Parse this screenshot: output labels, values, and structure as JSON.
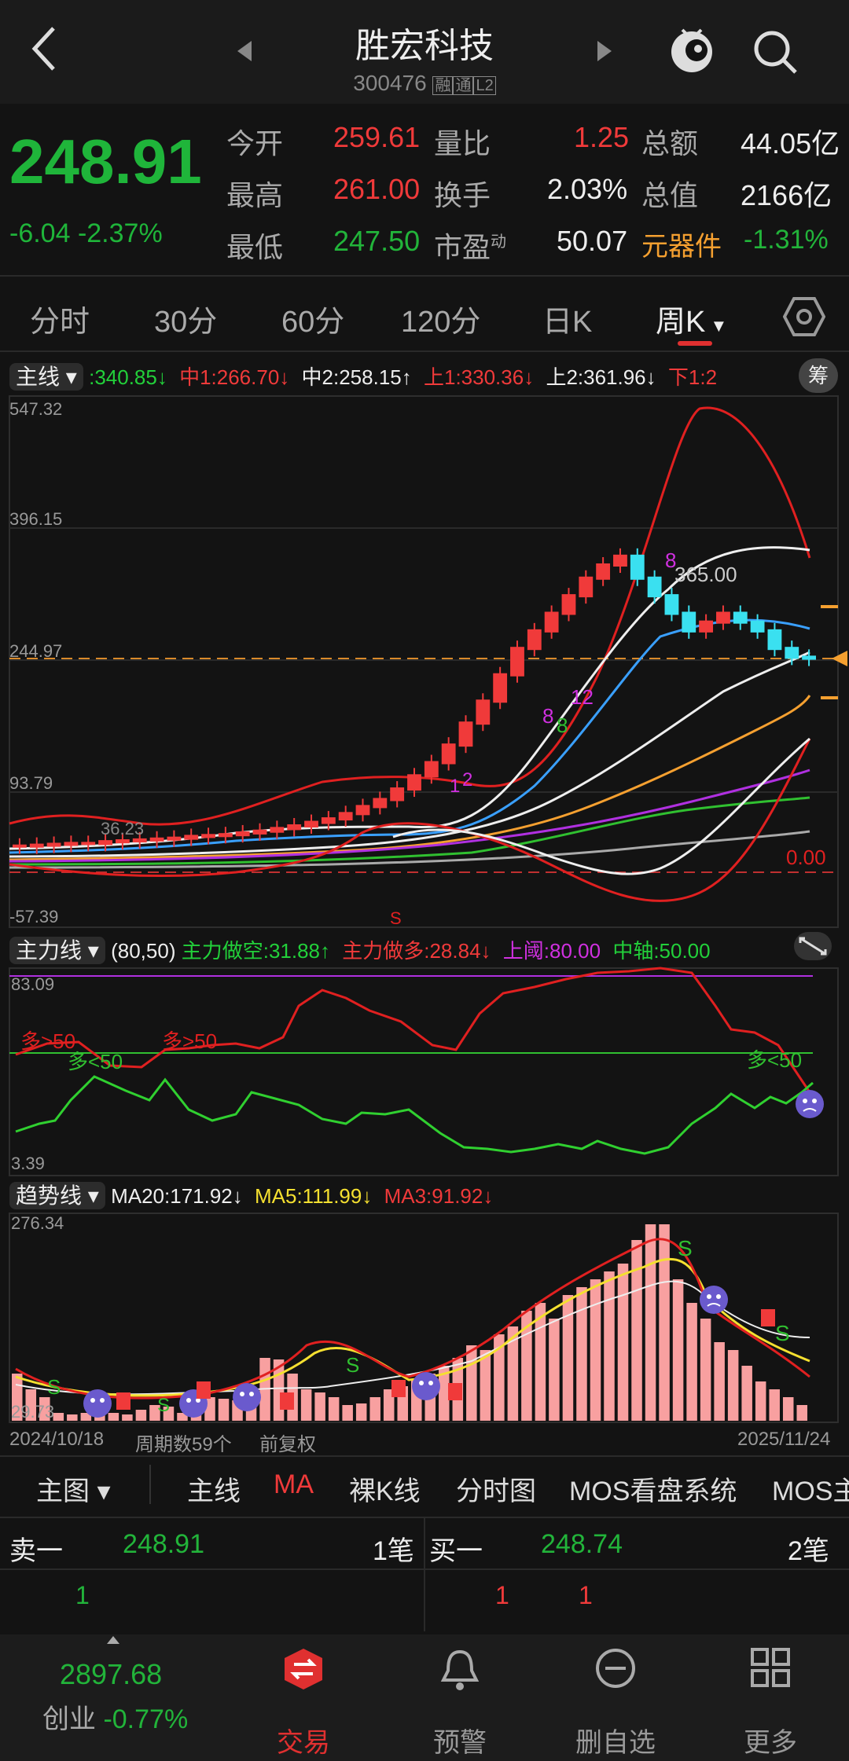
{
  "header": {
    "title": "胜宏科技",
    "code": "300476",
    "tags": [
      "融",
      "通",
      "L2"
    ]
  },
  "quote": {
    "price": "248.91",
    "change": "-6.04",
    "change_pct": "-2.37%",
    "rows": [
      [
        {
          "l": "今开",
          "v": "259.61",
          "c": "red"
        },
        {
          "l": "量比",
          "v": "1.25",
          "c": "red"
        },
        {
          "l": "总额",
          "v": "44.05亿",
          "c": "white"
        }
      ],
      [
        {
          "l": "最高",
          "v": "261.00",
          "c": "red"
        },
        {
          "l": "换手",
          "v": "2.03%",
          "c": "white"
        },
        {
          "l": "总值",
          "v": "2166亿",
          "c": "white"
        }
      ],
      [
        {
          "l": "最低",
          "v": "247.50",
          "c": "green"
        },
        {
          "l": "市盈",
          "v": "50.07",
          "c": "white"
        },
        {
          "l": "元器件",
          "v": "-1.31%",
          "c": "green"
        }
      ]
    ],
    "pe_sup": "动"
  },
  "tabs": [
    "分时",
    "30分",
    "60分",
    "120分",
    "日K",
    "周K"
  ],
  "main_ind": {
    "name": "主线",
    "vals": [
      ":340.85↓",
      "中1:266.70↓",
      "中2:258.15↑",
      "上1:330.36↓",
      "上2:361.96↓",
      "下1:2"
    ],
    "btn": "筹"
  },
  "main_axis": [
    "547.32",
    "396.15",
    "244.97",
    "93.79",
    "-57.39"
  ],
  "main_labels": {
    "hi": "365.00",
    "lo": "36.23",
    "zero": "0.00",
    "s": "S",
    "n1": "1",
    "n2": "2",
    "n8a": "8",
    "n8b": "8",
    "n12": "12",
    "n8c": "8"
  },
  "power": {
    "name": "主力线",
    "params": "(80,50)",
    "v1": "主力做空:31.88↑",
    "v2": "主力做多:28.84↓",
    "v3": "上阈:80.00",
    "v4": "中轴:50.00",
    "axis": [
      "83.09",
      "3.39"
    ],
    "notes": [
      "多>50",
      "多<50",
      "多>50",
      "多<50"
    ]
  },
  "trend": {
    "name": "趋势线",
    "v1": "MA20:171.92↓",
    "v2": "MA5:111.99↓",
    "v3": "MA3:91.92↓",
    "axis": [
      "276.34",
      "29.73"
    ]
  },
  "footer_info": {
    "start": "2024/10/18",
    "count": "周期数59个",
    "adj": "前复权",
    "end": "2025/11/24"
  },
  "chart_menu": {
    "main": "主图",
    "items": [
      "主线",
      "MA",
      "裸K线",
      "分时图",
      "MOS看盘系统",
      "MOS主"
    ]
  },
  "order": {
    "sell_label": "卖一",
    "sell_price": "248.91",
    "sell_qty": "1笔",
    "buy_label": "买一",
    "buy_price": "248.74",
    "buy_qty": "2笔",
    "sub_left": "1",
    "sub_right": [
      "1",
      "1"
    ]
  },
  "bottom": {
    "index_val": "2897.68",
    "index_name": "创业",
    "index_chg": "-0.77%",
    "nav": [
      "交易",
      "预警",
      "删自选",
      "更多"
    ]
  },
  "chart_data": {
    "type": "line",
    "title": "",
    "ylim": [
      -57.39,
      547.32
    ],
    "candles_close": [
      35,
      36,
      37,
      38,
      38,
      40,
      41,
      42,
      43,
      44,
      46,
      47,
      48,
      50,
      52,
      55,
      58,
      62,
      66,
      72,
      80,
      88,
      100,
      115,
      130,
      150,
      175,
      200,
      230,
      260,
      280,
      300,
      320,
      340,
      355,
      365,
      340,
      320,
      300,
      280,
      290,
      300,
      290,
      280,
      260,
      250,
      248.91
    ]
  }
}
